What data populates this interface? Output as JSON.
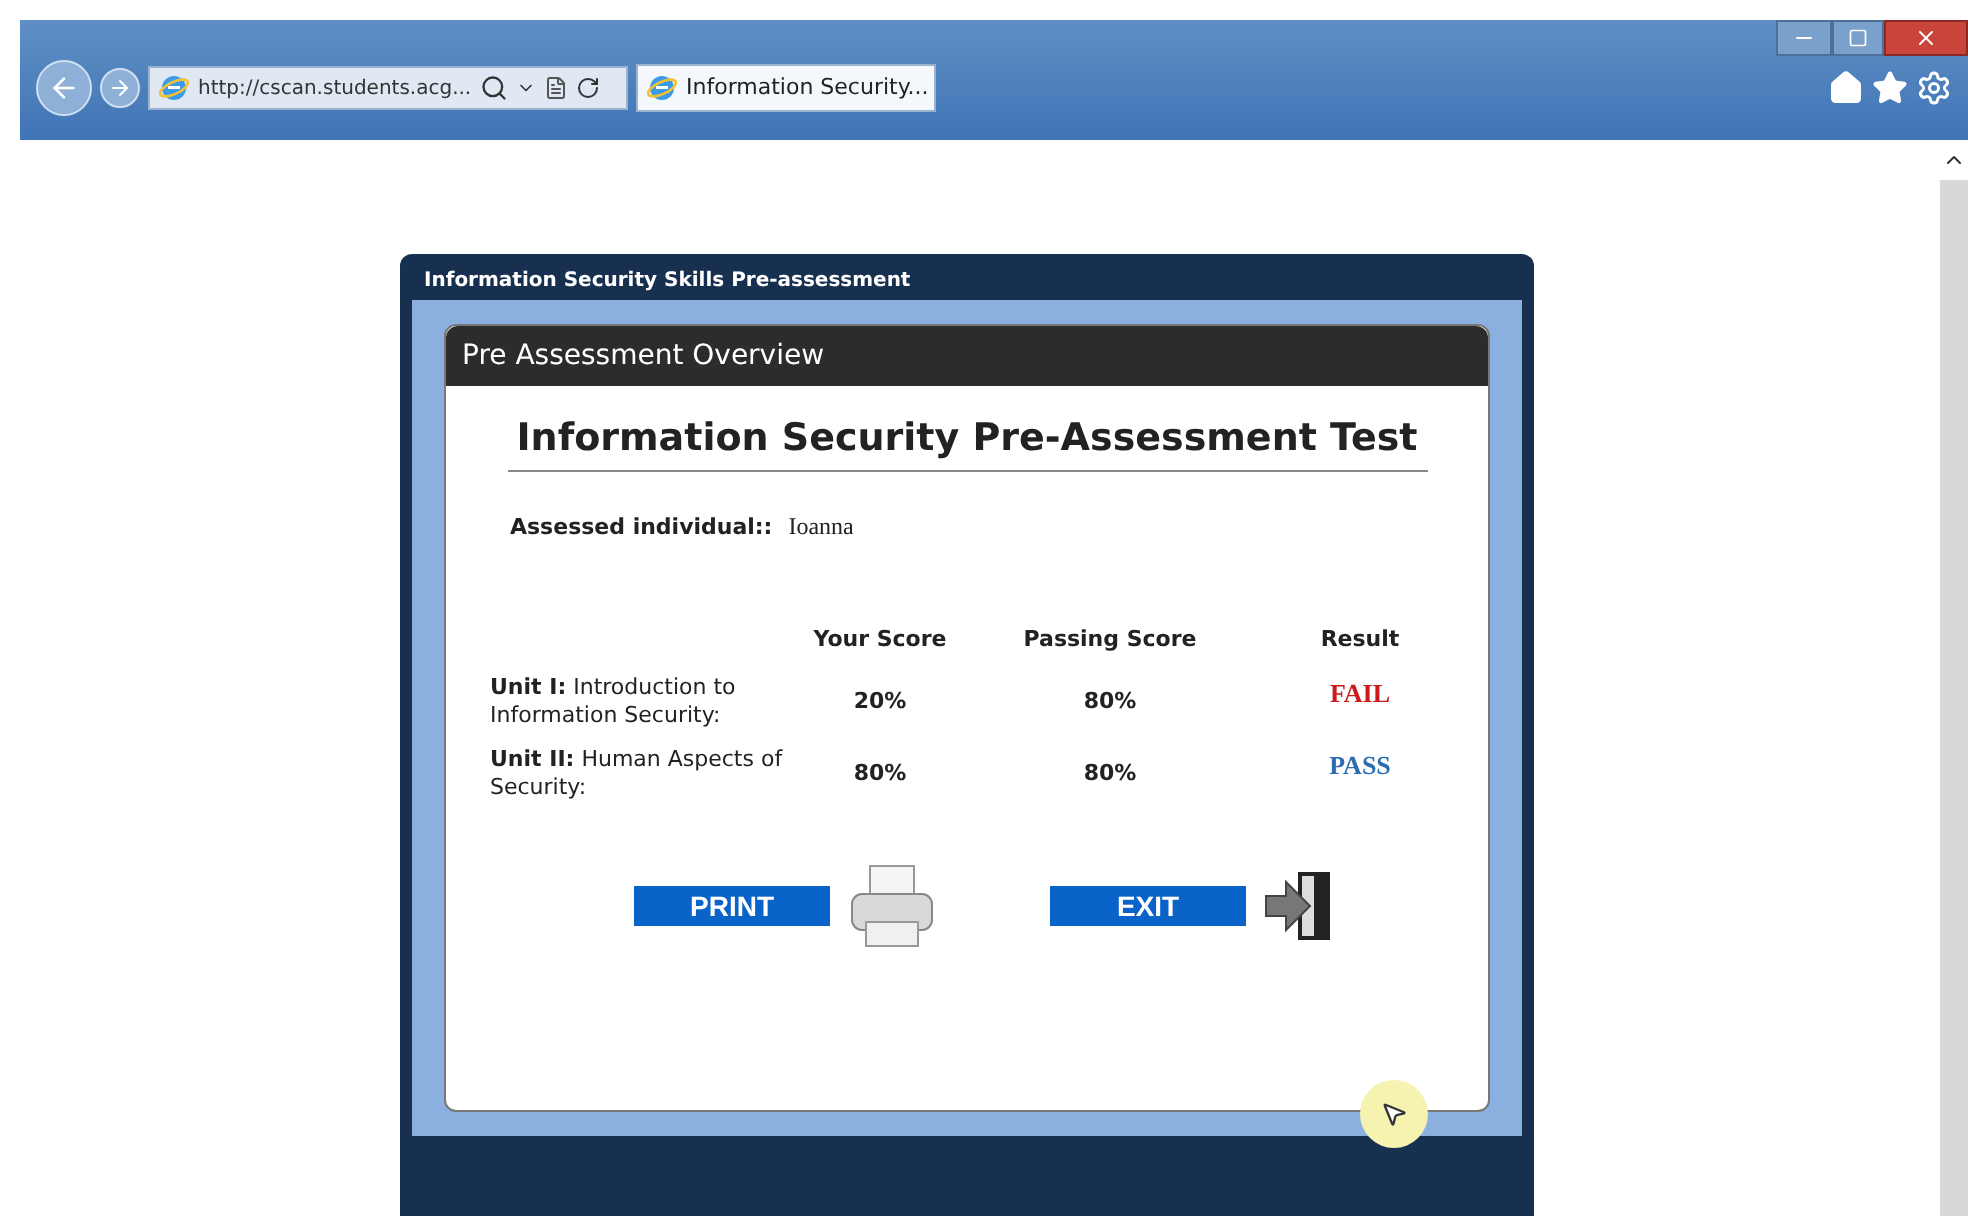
{
  "browser": {
    "address": "http://cscan.students.acg...",
    "tab_title": "Information Security..."
  },
  "app": {
    "title": "Information Security Skills Pre-assessment",
    "section_title": "Pre Assessment Overview",
    "heading": "Information Security Pre-Assessment Test",
    "assessed_label": "Assessed individual::",
    "assessed_name": "Ioanna",
    "columns": [
      "Your Score",
      "Passing Score",
      "Result"
    ],
    "rows": [
      {
        "unit": "**Unit I:** Introduction to Information Security:",
        "your_score": "20%",
        "passing_score": "80%",
        "result": "FAIL",
        "color": "#cc1a1a"
      },
      {
        "unit": "**Unit II:** Human Aspects of Security:",
        "your_score": "80%",
        "passing_score": "80%",
        "result": "PASS",
        "color": "#2a6db0"
      }
    ],
    "buttons": [
      {
        "label": "PRINT",
        "kind": "print"
      },
      {
        "label": "EXIT",
        "kind": "exit"
      }
    ]
  }
}
